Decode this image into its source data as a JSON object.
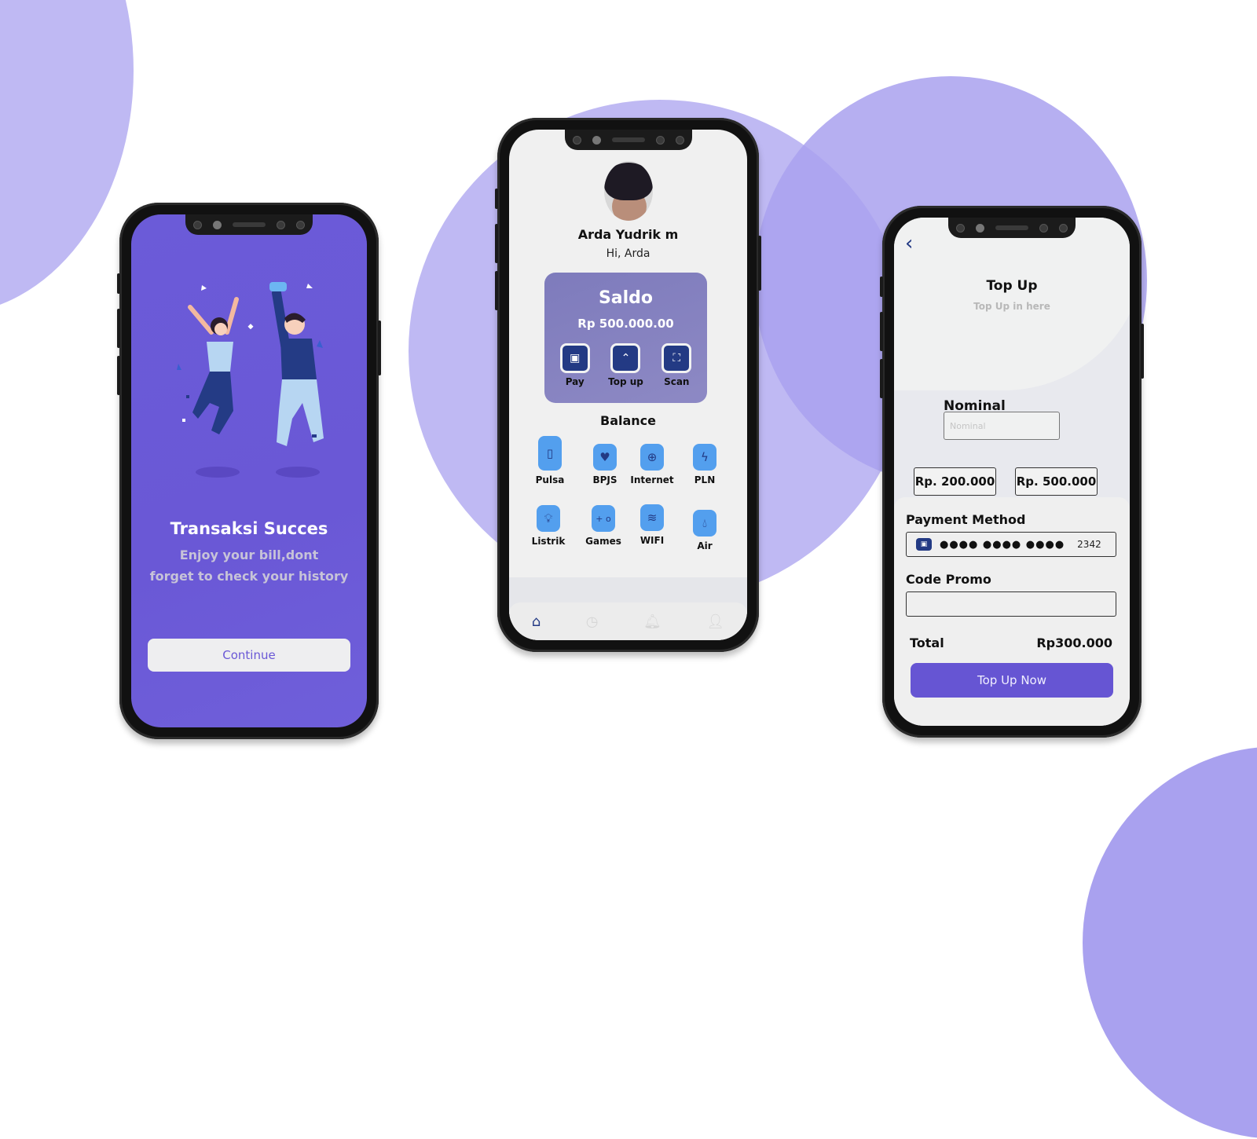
{
  "colors": {
    "accent_purple": "#6a58d6",
    "blob_light": "#bfb9f3",
    "blob_medium": "#a9a1ef",
    "saldo_card": "#8583c0",
    "icon_navy": "#233a84",
    "service_blue": "#539fee"
  },
  "success_screen": {
    "title": "Transaksi Succes",
    "subtitle_line1": "Enjoy your bill,dont",
    "subtitle_line2": "forget to check your history",
    "continue_label": "Continue",
    "illustration": "celebration-two-people-jumping"
  },
  "home_screen": {
    "user_name": "Arda Yudrik m",
    "greeting": "Hi, Arda",
    "saldo_title": "Saldo",
    "saldo_amount": "Rp 500.000.00",
    "quick_actions": [
      {
        "label": "Pay",
        "icon": "wallet-icon"
      },
      {
        "label": "Top up",
        "icon": "top-up-icon"
      },
      {
        "label": "Scan",
        "icon": "scan-icon"
      }
    ],
    "balance_label": "Balance",
    "services": [
      {
        "label": "Pulsa",
        "icon": "phone-icon"
      },
      {
        "label": "BPJS",
        "icon": "heart-icon"
      },
      {
        "label": "Internet",
        "icon": "globe-icon"
      },
      {
        "label": "PLN",
        "icon": "lightning-icon"
      },
      {
        "label": "Listrik",
        "icon": "lightbulb-icon"
      },
      {
        "label": "Games",
        "icon": "gamepad-icon"
      },
      {
        "label": "WIFI",
        "icon": "wifi-icon"
      },
      {
        "label": "Air",
        "icon": "water-drop-icon"
      }
    ],
    "nav": [
      {
        "name": "home",
        "icon": "home-icon",
        "active": true
      },
      {
        "name": "history",
        "icon": "clock-icon",
        "active": false
      },
      {
        "name": "notifications",
        "icon": "bell-icon",
        "active": false
      },
      {
        "name": "profile",
        "icon": "user-icon",
        "active": false
      }
    ]
  },
  "topup_screen": {
    "title": "Top Up",
    "subtitle": "Top Up in here",
    "nominal_label": "Nominal",
    "nominal_placeholder": "Nominal",
    "nominal_value": "",
    "amount_options": [
      "Rp. 200.000",
      "Rp. 500.000"
    ],
    "payment_method_label": "Payment Method",
    "card_mask": "●●●● ●●●● ●●●●",
    "card_last4": "2342",
    "promo_label": "Code Promo",
    "promo_value": "",
    "total_label": "Total",
    "total_value": "Rp300.000",
    "submit_label": "Top Up Now"
  }
}
